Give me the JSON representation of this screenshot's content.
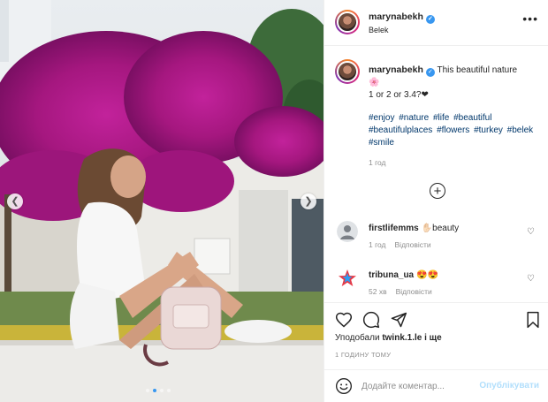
{
  "post": {
    "author": {
      "username": "marynabekh",
      "verified": true,
      "location": "Belek"
    },
    "caption": {
      "text": "This beautiful nature",
      "emoji": "🌸",
      "line2": "1 or 2 or 3.4?❤",
      "hashtags": [
        "#enjoy",
        "#nature",
        "#life",
        "#beautiful",
        "#beautifulplaces",
        "#flowers",
        "#turkey",
        "#belek",
        "#smile"
      ],
      "time": "1 год"
    },
    "carousel": {
      "slide_count": 4,
      "active_slide": 1,
      "prev_icon": "chevron-left-icon",
      "next_icon": "chevron-right-icon"
    }
  },
  "comments": [
    {
      "username": "firstlifemms",
      "text": "✋🏻beauty",
      "time": "1 год",
      "reply_label": "Відповісти"
    },
    {
      "username": "tribuna_ua",
      "text": "😍😍",
      "time": "52 хв",
      "reply_label": "Відповісти"
    }
  ],
  "actions": {
    "likes_prefix": "Уподобали",
    "likes_user": "twink.1.le",
    "likes_suffix": "і ще",
    "post_time": "1 ГОДИНУ ТОМУ"
  },
  "comment_box": {
    "placeholder": "Додайте коментар...",
    "publish_label": "Опублікувати"
  },
  "colors": {
    "link": "#00376b",
    "verified": "#3897f0",
    "publish_disabled": "#b2dffc",
    "muted": "#8e8e8e",
    "blossom": "#b0188a"
  }
}
